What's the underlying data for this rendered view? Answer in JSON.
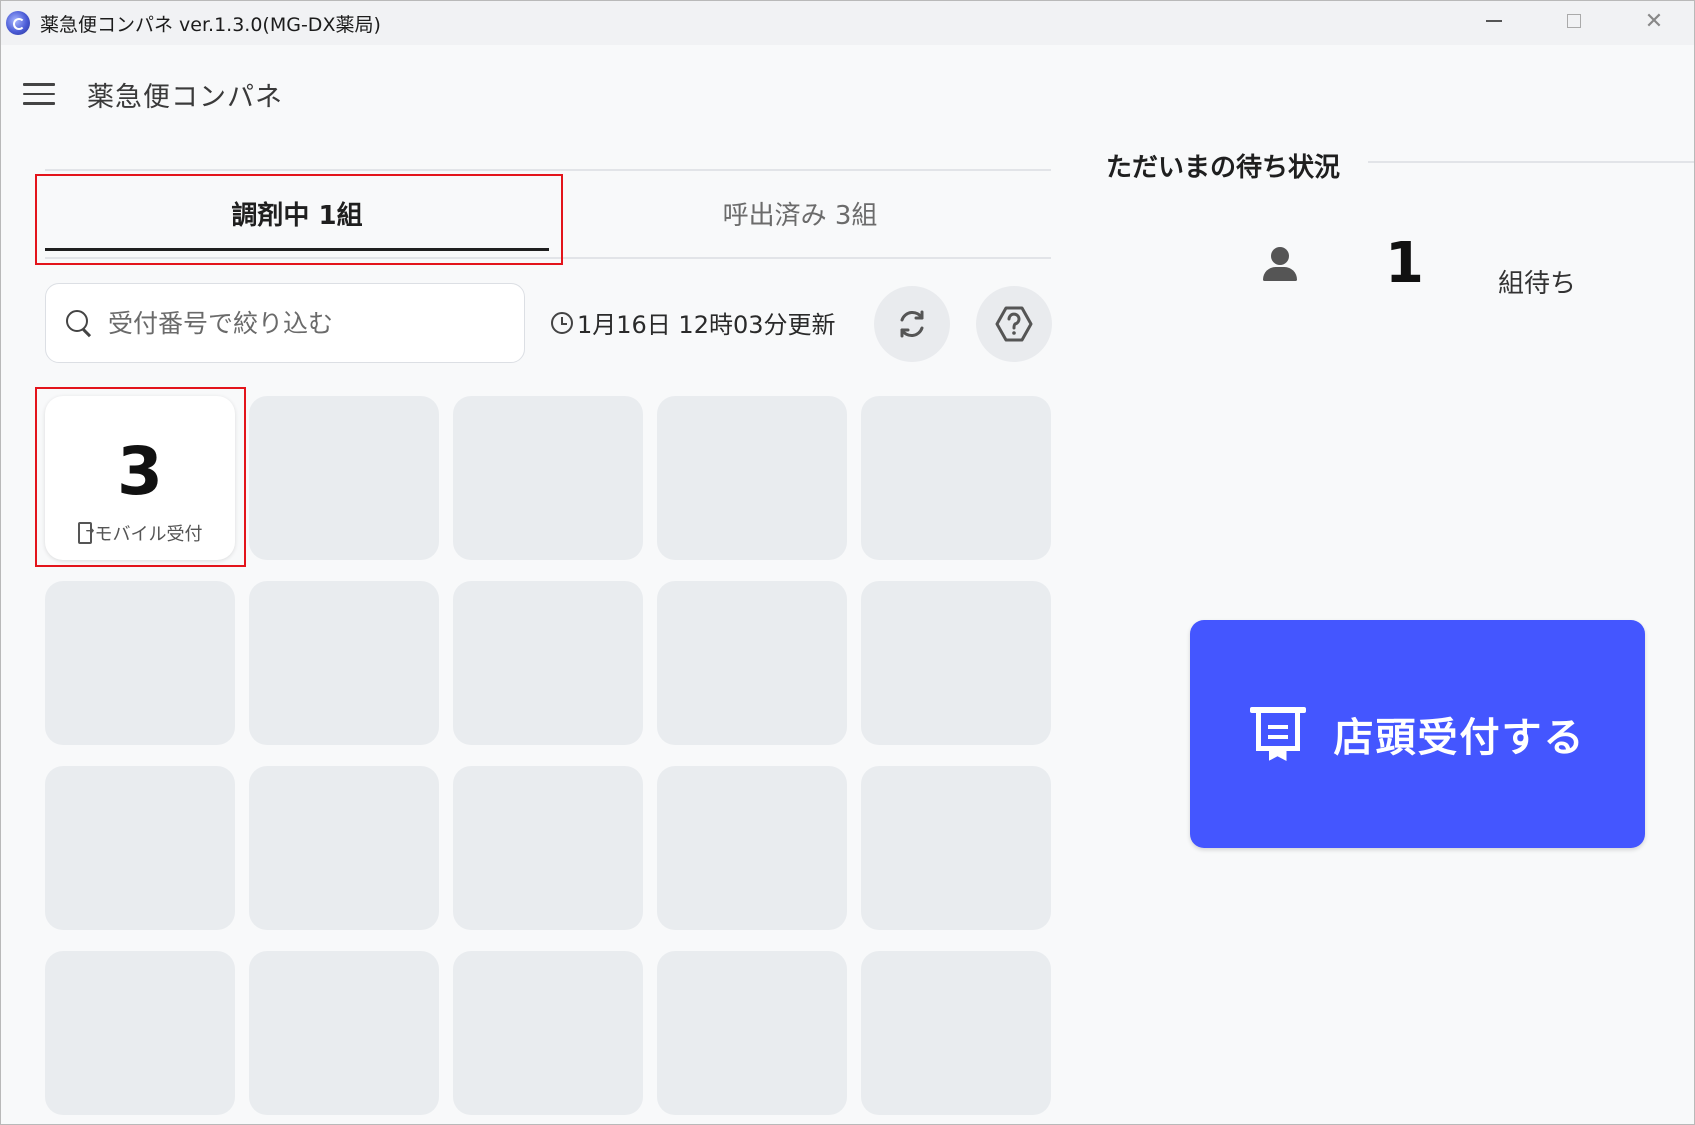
{
  "window": {
    "title": "薬急便コンパネ ver.1.3.0(MG-DX薬局)",
    "minimize_icon": "minimize-icon",
    "maximize_icon": "maximize-icon",
    "close_glyph": "✕"
  },
  "header": {
    "app_title": "薬急便コンパネ",
    "menu_icon": "hamburger-menu-icon"
  },
  "tabs": [
    {
      "label": "調剤中 1組",
      "active": true
    },
    {
      "label": "呼出済み 3組",
      "active": false
    }
  ],
  "toolbar": {
    "search_placeholder": "受付番号で絞り込む",
    "updated_text": "1月16日 12時03分更新",
    "refresh_icon": "refresh-icon",
    "help_icon": "help-icon"
  },
  "grid": {
    "columns": 5,
    "rows": 4,
    "items": [
      {
        "number": "3",
        "label": "モバイル受付",
        "icon": "mobile-checkin-icon"
      }
    ]
  },
  "waiting": {
    "title": "ただいまの待ち状況",
    "count": "1",
    "unit": "組待ち",
    "icon": "person-icon"
  },
  "counter_button": {
    "label": "店頭受付する",
    "icon": "receipt-register-icon",
    "color": "#4456ff"
  },
  "colors": {
    "highlight": "#e3141b",
    "accent": "#4456ff",
    "cell_empty": "#e9ecef",
    "background": "#f8f9fa"
  }
}
